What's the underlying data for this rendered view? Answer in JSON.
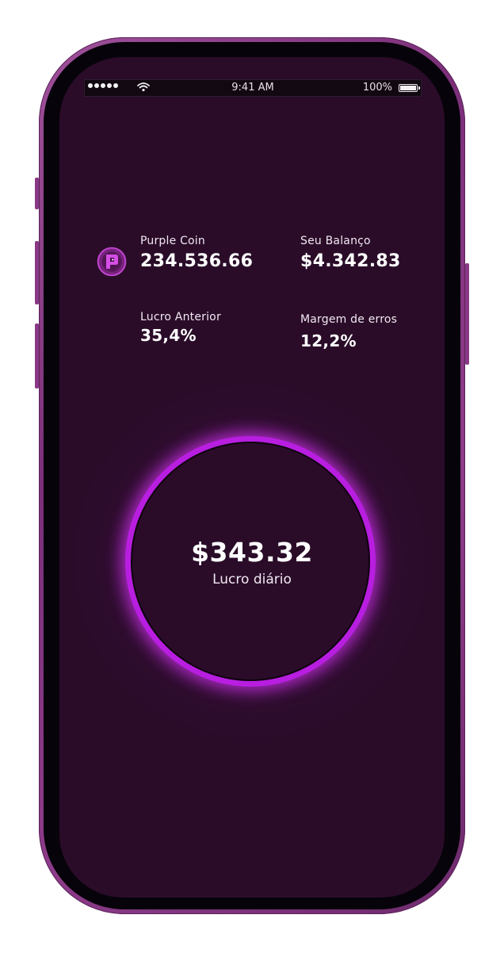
{
  "status_bar": {
    "time": "9:41 AM",
    "battery_percent": "100%",
    "battery_level": 1.0
  },
  "stats": {
    "coin": {
      "label": "Purple Coin",
      "value": "234.536.66"
    },
    "balance": {
      "label": "Seu Balanço",
      "value": "$4.342.83"
    },
    "previous_profit": {
      "label": "Lucro Anterior",
      "value": "35,4%"
    },
    "error_margin": {
      "label": "Margem de erros",
      "value": "12,2%"
    }
  },
  "daily": {
    "value": "$343.32",
    "label": "Lucro diário"
  },
  "colors": {
    "background": "#2a0c29",
    "accent": "#b81ee0",
    "frame": "#8d3c8a"
  },
  "icons": {
    "coin_logo": "purple-coin-logo-icon",
    "signal": "signal-dots-icon",
    "wifi": "wifi-icon",
    "battery": "battery-icon"
  }
}
